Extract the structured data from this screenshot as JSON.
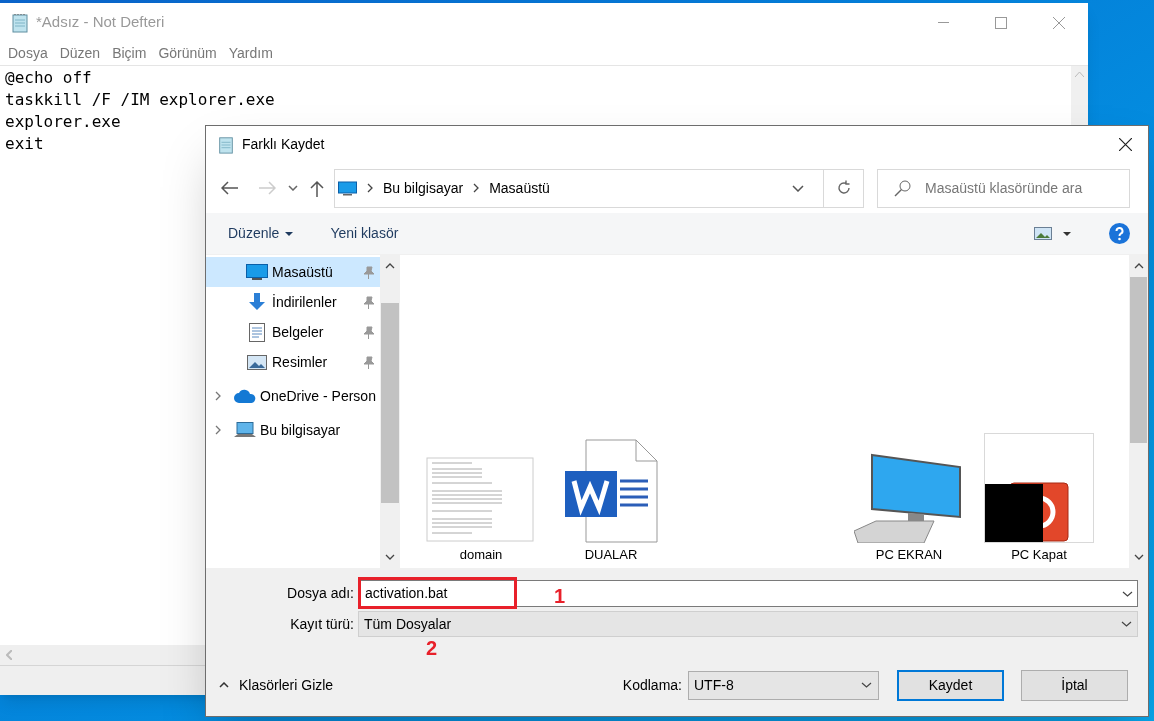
{
  "notepad": {
    "title": "*Adsız - Not Defteri",
    "menu": [
      "Dosya",
      "Düzen",
      "Biçim",
      "Görünüm",
      "Yardım"
    ],
    "lines": [
      "@echo off",
      "taskkill /F /IM explorer.exe",
      "explorer.exe",
      "exit"
    ]
  },
  "dialog": {
    "title": "Farklı Kaydet",
    "breadcrumb": [
      "Bu bilgisayar",
      "Masaüstü"
    ],
    "search": {
      "placeholder": "Masaüstü klasöründe ara"
    },
    "toolbar": [
      "Düzenle",
      "Yeni klasör"
    ],
    "sidebar": [
      {
        "label": "Masaüstü",
        "kind": "desktop",
        "selected": true
      },
      {
        "label": "İndirilenler",
        "kind": "download",
        "selected": false
      },
      {
        "label": "Belgeler",
        "kind": "documents",
        "selected": false
      },
      {
        "label": "Resimler",
        "kind": "pictures",
        "selected": false
      },
      {
        "label": "OneDrive - Person",
        "kind": "cloud",
        "selected": false
      },
      {
        "label": "Bu bilgisayar",
        "kind": "computer",
        "selected": false
      }
    ],
    "files": [
      {
        "name": "domain",
        "kind": "textfile"
      },
      {
        "name": "DUALAR",
        "kind": "word"
      },
      {
        "name": "PC EKRAN",
        "kind": "monitor"
      },
      {
        "name": "PC Kapat",
        "kind": "power"
      }
    ],
    "filename": {
      "label": "Dosya adı:",
      "value": "activation.bat"
    },
    "filetype": {
      "label": "Kayıt türü:",
      "value": "Tüm Dosyalar"
    },
    "encoding": {
      "label": "Kodlama:",
      "value": "UTF-8"
    },
    "hide_folders": "Klasörleri Gizle",
    "buttons": [
      {
        "label": "Kaydet",
        "kind": "default"
      },
      {
        "label": "İptal",
        "kind": "normal"
      }
    ]
  },
  "annotations": [
    "1",
    "2"
  ]
}
